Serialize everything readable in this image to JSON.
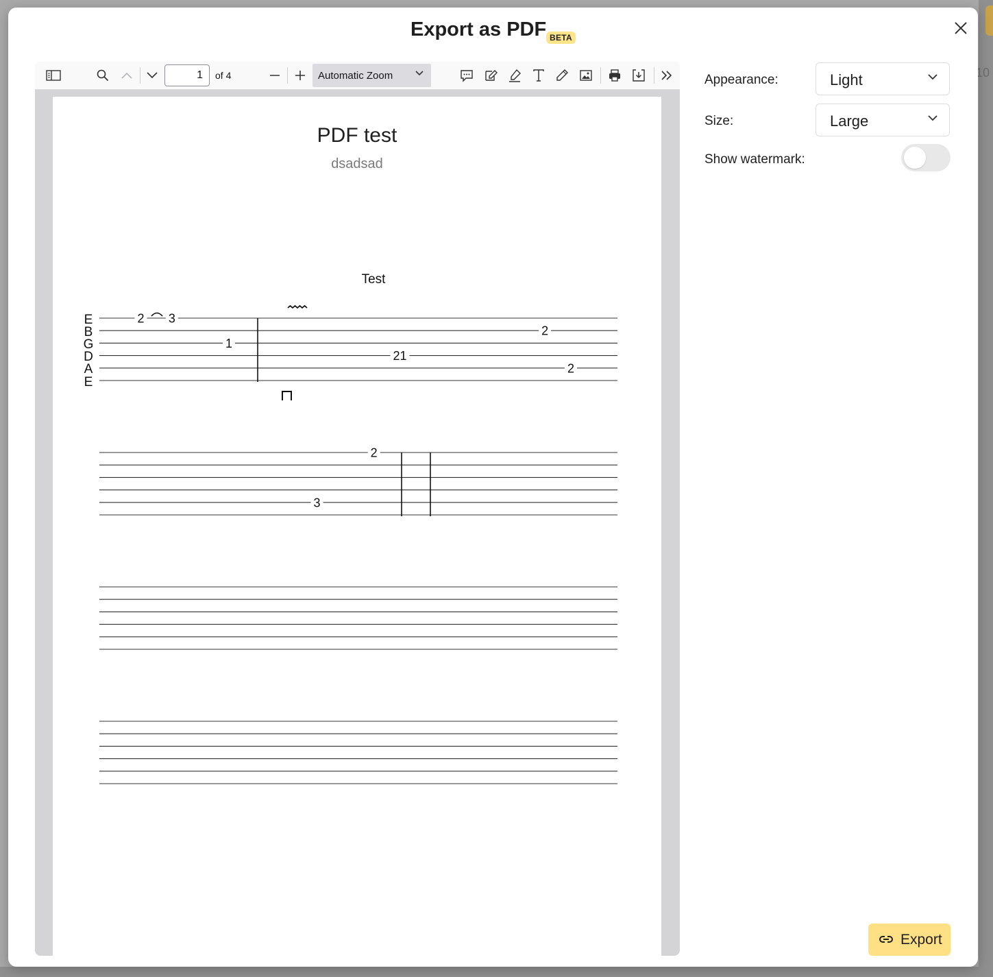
{
  "dialog": {
    "title": "Export as PDF",
    "badge": "BETA",
    "close_icon": "close-icon"
  },
  "background": {
    "partial_number": "10"
  },
  "viewer": {
    "toolbar": {
      "sidebar_icon": "sidebar-toggle-icon",
      "find_icon": "search-icon",
      "prev_icon": "chevron-up-icon",
      "next_icon": "chevron-down-icon",
      "page_number": "1",
      "page_count_label": "of 4",
      "zoom_out_icon": "minus-icon",
      "zoom_in_icon": "plus-icon",
      "zoom_value": "Automatic Zoom",
      "tools": [
        "comment-icon",
        "signature-icon",
        "highlight-icon",
        "text-icon",
        "draw-icon",
        "image-icon",
        "print-icon",
        "download-icon",
        "more-tools-icon"
      ]
    },
    "document": {
      "title": "PDF test",
      "subtitle": "dsadsad",
      "section_label": "Test",
      "string_names": [
        "E",
        "B",
        "G",
        "D",
        "A",
        "E"
      ],
      "systems": [
        {
          "notes": [
            {
              "string": 1,
              "fret": "2",
              "pos": 0.08
            },
            {
              "string": 1,
              "fret": "3",
              "pos": 0.14
            },
            {
              "string": 3,
              "fret": "1",
              "pos": 0.25
            },
            {
              "string": 4,
              "fret": "21",
              "pos": 0.58
            },
            {
              "string": 2,
              "fret": "2",
              "pos": 0.86
            },
            {
              "string": 5,
              "fret": "2",
              "pos": 0.91
            }
          ]
        },
        {
          "notes": [
            {
              "string": 1,
              "fret": "2",
              "pos": 0.53
            },
            {
              "string": 5,
              "fret": "3",
              "pos": 0.42
            }
          ]
        },
        {
          "notes": []
        },
        {
          "notes": []
        }
      ]
    }
  },
  "settings": {
    "appearance_label": "Appearance:",
    "appearance_value": "Light",
    "size_label": "Size:",
    "size_value": "Large",
    "watermark_label": "Show watermark:",
    "watermark_on": false
  },
  "export_button": {
    "label": "Export",
    "icon": "link-icon"
  },
  "colors": {
    "accent": "#ffe085",
    "badge": "#ffe58a"
  }
}
